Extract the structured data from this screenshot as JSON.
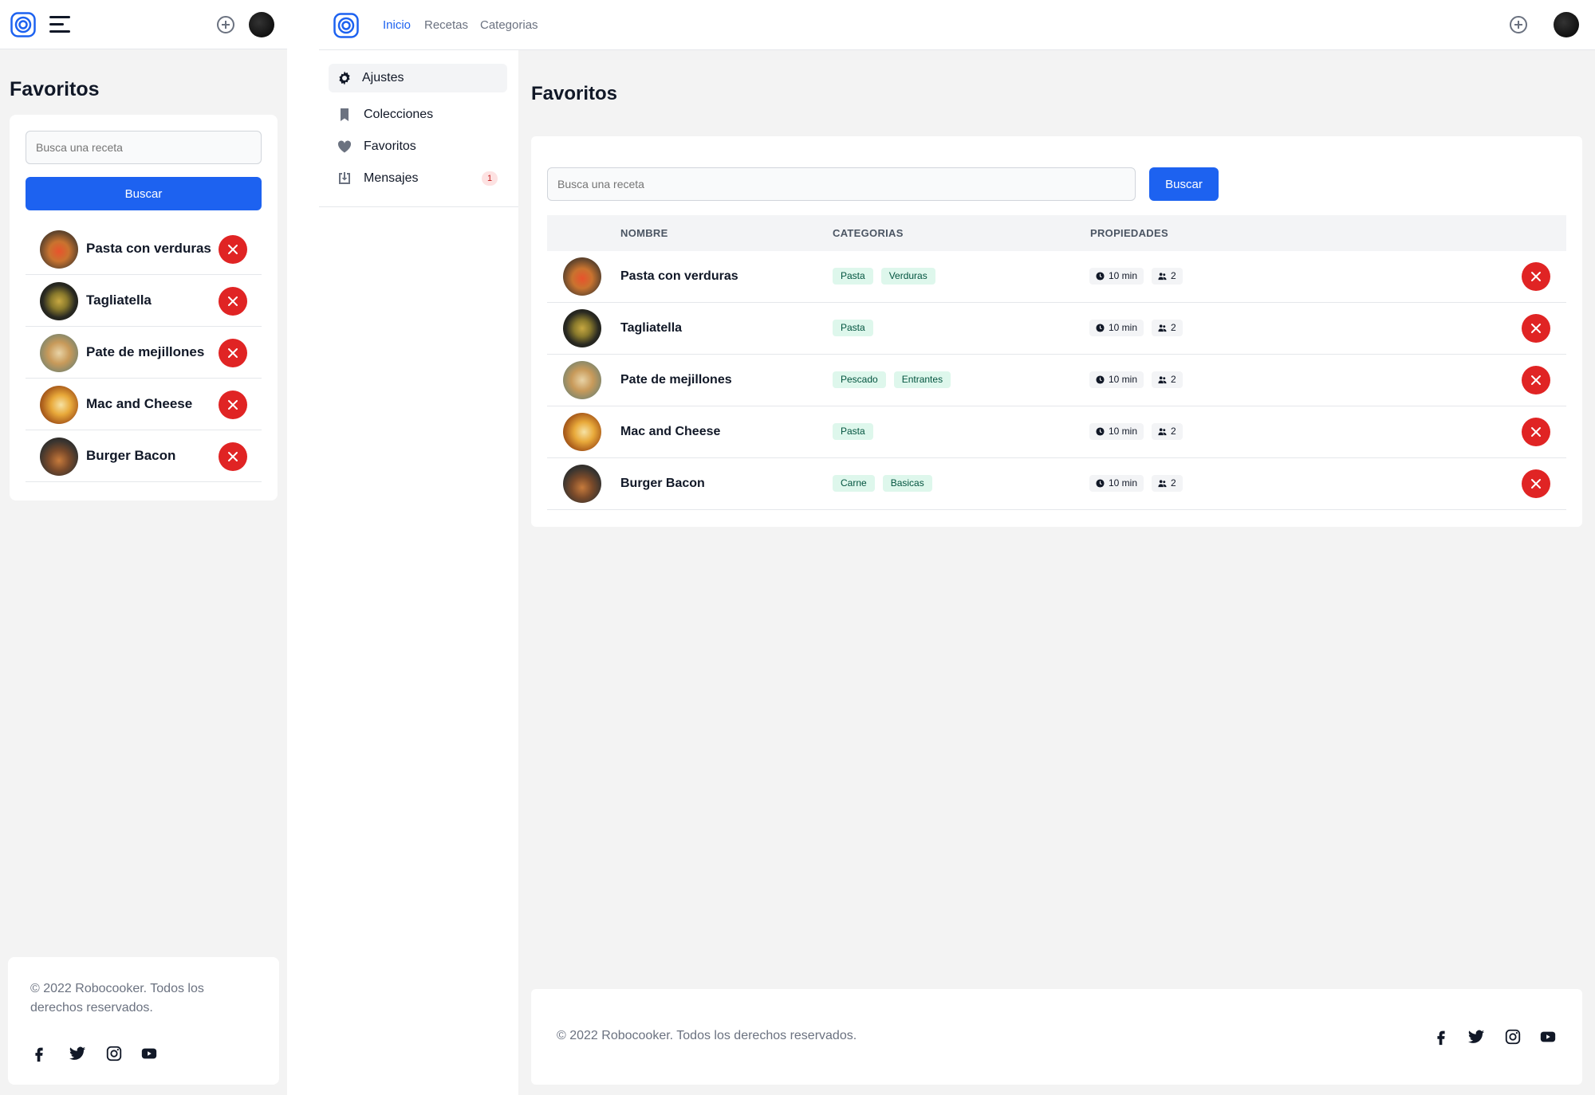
{
  "brand": {
    "color": "#1d62f0",
    "danger": "#e02424"
  },
  "nav": {
    "links": [
      "Inicio",
      "Recetas",
      "Categorias"
    ],
    "active": "Inicio"
  },
  "sidebar": {
    "items": [
      {
        "label": "Ajustes",
        "icon": "gear-icon",
        "active": true
      },
      {
        "label": "Colecciones",
        "icon": "bookmark-icon"
      },
      {
        "label": "Favoritos",
        "icon": "heart-icon"
      },
      {
        "label": "Mensajes",
        "icon": "inbox-icon",
        "badge": "1"
      }
    ]
  },
  "page": {
    "title": "Favoritos"
  },
  "search": {
    "placeholder": "Busca una receta",
    "button_label": "Buscar"
  },
  "table": {
    "headers": [
      "NOMBRE",
      "CATEGORIAS",
      "PROPIEDADES"
    ],
    "rows": [
      {
        "name": "Pasta con verduras",
        "categories": [
          "Pasta",
          "Verduras"
        ],
        "time": "10 min",
        "people": "2"
      },
      {
        "name": "Tagliatella",
        "categories": [
          "Pasta"
        ],
        "time": "10 min",
        "people": "2"
      },
      {
        "name": "Pate de mejillones",
        "categories": [
          "Pescado",
          "Entrantes"
        ],
        "time": "10 min",
        "people": "2"
      },
      {
        "name": "Mac and Cheese",
        "categories": [
          "Pasta"
        ],
        "time": "10 min",
        "people": "2"
      },
      {
        "name": "Burger Bacon",
        "categories": [
          "Carne",
          "Basicas"
        ],
        "time": "10 min",
        "people": "2"
      }
    ]
  },
  "footer": {
    "copyright": "© 2022 Robocooker. Todos los derechos reservados.",
    "social": [
      "facebook-icon",
      "twitter-icon",
      "instagram-icon",
      "youtube-icon"
    ]
  }
}
